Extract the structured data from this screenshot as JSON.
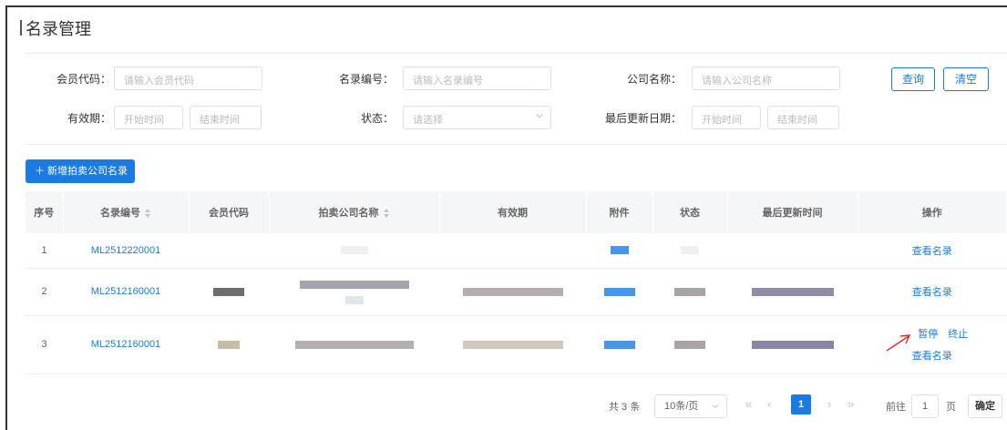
{
  "page": {
    "title": "名录管理"
  },
  "filters": {
    "member_code": {
      "label": "会员代码：",
      "placeholder": "请输入会员代码"
    },
    "list_no": {
      "label": "名录编号：",
      "placeholder": "请输入名录编号"
    },
    "company_name": {
      "label": "公司名称：",
      "placeholder": "请输入公司名称"
    },
    "validity": {
      "label": "有效期：",
      "start_placeholder": "开始时间",
      "end_placeholder": "结束时间"
    },
    "status": {
      "label": "状态：",
      "placeholder": "请选择"
    },
    "last_update": {
      "label": "最后更新日期：",
      "start_placeholder": "开始时间",
      "end_placeholder": "结束时间"
    },
    "query_label": "查询",
    "clear_label": "清空"
  },
  "toolbar": {
    "add_label": "＋ 新增拍卖公司名录"
  },
  "table": {
    "headers": [
      "序号",
      "名录编号",
      "会员代码",
      "拍卖公司名称",
      "有效期",
      "附件",
      "状态",
      "最后更新时间",
      "操作"
    ],
    "rows": [
      {
        "index": "1",
        "code": "ML2512220001",
        "actions": [
          "查看名录"
        ]
      },
      {
        "index": "2",
        "code": "ML2512160001",
        "actions": [
          "查看名录"
        ]
      },
      {
        "index": "3",
        "code": "ML2512160001",
        "actions": [
          "暂停",
          "终止",
          "查看名录"
        ]
      }
    ]
  },
  "pagination": {
    "total": "共 3 条",
    "page_size": "10条/页",
    "current_page": "1",
    "goto_prefix": "前往",
    "goto_value": "1",
    "goto_suffix": "页",
    "confirm_label": "确定"
  },
  "colors": {
    "accent": "#1a7ce0",
    "header_bg": "#f5f6f8",
    "annotation": "#e0302a"
  }
}
